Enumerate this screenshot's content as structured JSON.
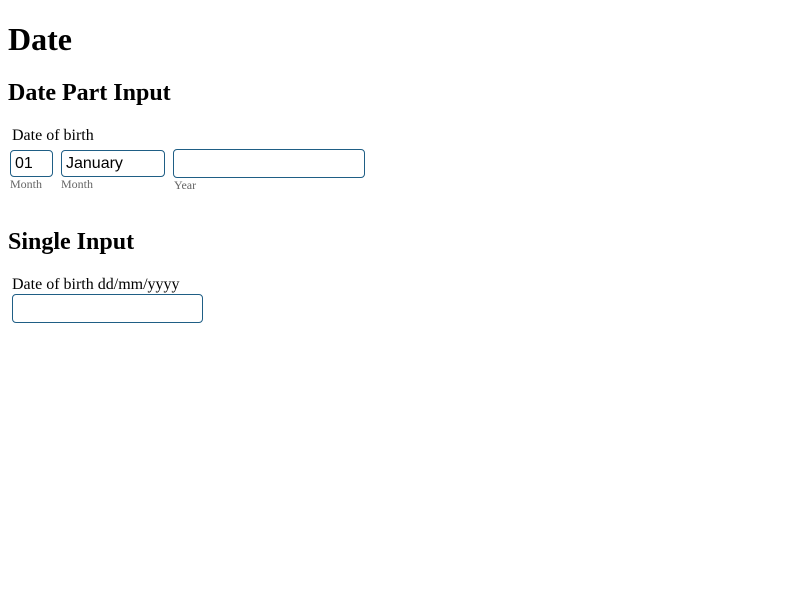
{
  "page": {
    "title": "Date"
  },
  "date_part_section": {
    "heading": "Date Part Input",
    "label": "Date of birth",
    "day": {
      "value": "01",
      "hint": "Month"
    },
    "month": {
      "value": "January",
      "hint": "Month"
    },
    "year": {
      "value": "",
      "hint": "Year"
    }
  },
  "single_section": {
    "heading": "Single Input",
    "label": "Date of birth dd/mm/yyyy",
    "value": ""
  },
  "colors": {
    "input_border": "#1f5e85",
    "hint_text": "#666666"
  }
}
